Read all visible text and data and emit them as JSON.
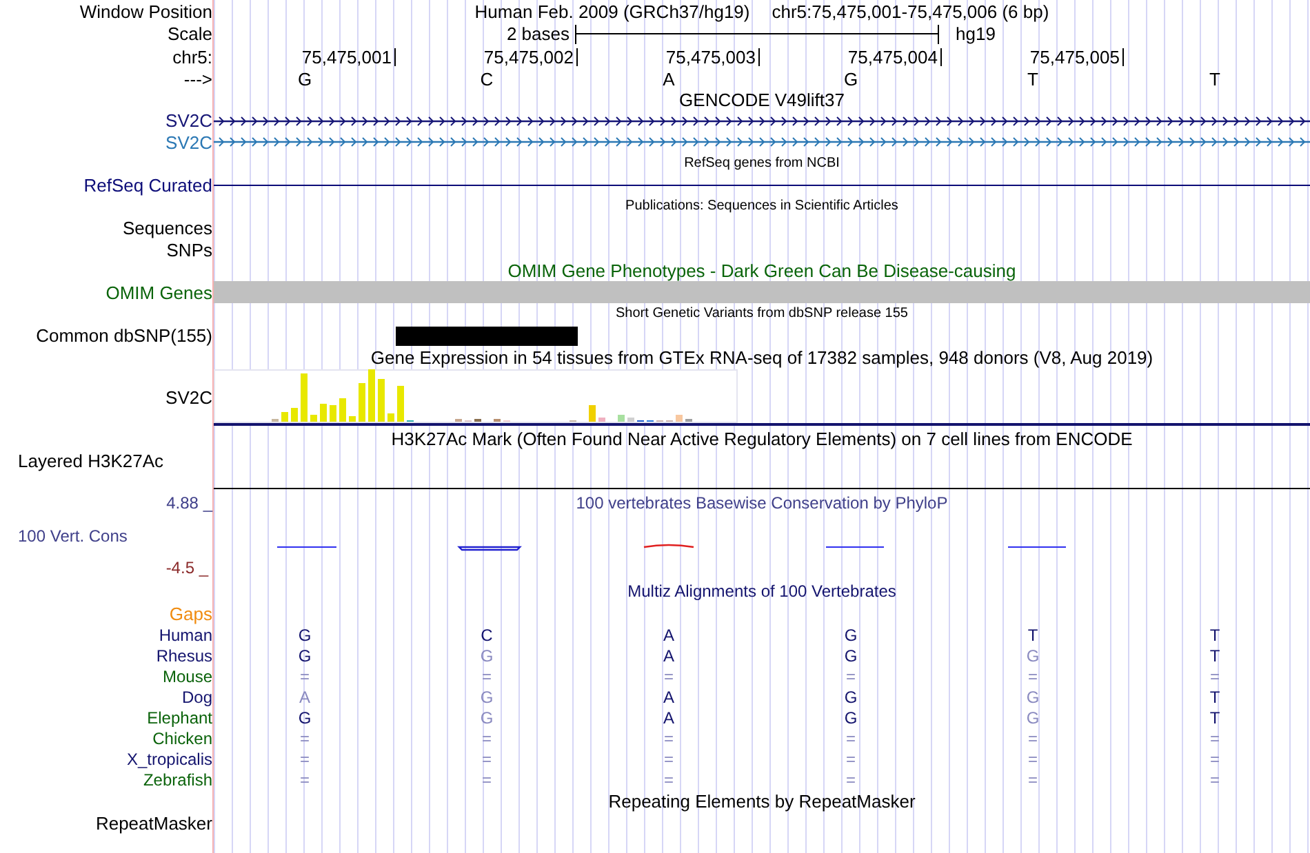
{
  "header": {
    "label": "Window Position",
    "assembly_title": "Human Feb. 2009 (GRCh37/hg19)",
    "position_title": "chr5:75,475,001-75,475,006 (6 bp)"
  },
  "scale": {
    "label": "Scale",
    "text": "2 bases",
    "assembly": "hg19"
  },
  "ruler": {
    "label": "chr5:",
    "positions": [
      "75,475,001",
      "75,475,002",
      "75,475,003",
      "75,475,004",
      "75,475,005"
    ]
  },
  "bases": {
    "label": "--->",
    "sequence": [
      "G",
      "C",
      "A",
      "G",
      "T",
      "T"
    ]
  },
  "gencode": {
    "title": "GENCODE V49lift37",
    "genes": [
      {
        "label": "SV2C",
        "color": "#161676"
      },
      {
        "label": "SV2C",
        "color": "#2b78b4"
      }
    ]
  },
  "refseq": {
    "title": "RefSeq genes from NCBI",
    "label": "RefSeq Curated"
  },
  "publications": {
    "title": "Publications: Sequences in Scientific Articles",
    "label": "Sequences"
  },
  "snps": {
    "label": "SNPs"
  },
  "omim": {
    "title": "OMIM Gene Phenotypes - Dark Green Can Be Disease-causing",
    "label": "OMIM Genes"
  },
  "dbsnp": {
    "title": "Short Genetic Variants from dbSNP release 155",
    "label": "Common dbSNP(155)"
  },
  "gtex": {
    "title": "Gene Expression in 54 tissues from GTEx RNA-seq of 17382 samples, 948 donors (V8, Aug 2019)",
    "label": "SV2C"
  },
  "h3k27ac": {
    "title": "H3K27Ac Mark (Often Found Near Active Regulatory Elements) on 7 cell lines from ENCODE",
    "label": "Layered H3K27Ac"
  },
  "phylop": {
    "title": "100 vertebrates Basewise Conservation by PhyloP",
    "label": "100 Vert. Cons",
    "max": "4.88 _",
    "min": "-4.5 _"
  },
  "multiz": {
    "title": "Multiz Alignments of 100 Vertebrates",
    "gaps_label": "Gaps",
    "species": [
      {
        "name": "Human",
        "color": "#14146e",
        "bases": [
          {
            "text": "G",
            "match": true
          },
          {
            "text": "C",
            "match": true
          },
          {
            "text": "A",
            "match": true
          },
          {
            "text": "G",
            "match": true
          },
          {
            "text": "T",
            "match": true
          },
          {
            "text": "T",
            "match": true
          }
        ]
      },
      {
        "name": "Rhesus",
        "color": "#14146e",
        "bases": [
          {
            "text": "G",
            "match": true
          },
          {
            "text": "G",
            "match": false
          },
          {
            "text": "A",
            "match": true
          },
          {
            "text": "G",
            "match": true
          },
          {
            "text": "G",
            "match": false
          },
          {
            "text": "T",
            "match": true
          }
        ]
      },
      {
        "name": "Mouse",
        "color": "#0b630b",
        "bases": [
          {
            "text": "=",
            "match": false
          },
          {
            "text": "=",
            "match": false
          },
          {
            "text": "=",
            "match": false
          },
          {
            "text": "=",
            "match": false
          },
          {
            "text": "=",
            "match": false
          },
          {
            "text": "=",
            "match": false
          }
        ]
      },
      {
        "name": "Dog",
        "color": "#14146e",
        "bases": [
          {
            "text": "A",
            "match": false
          },
          {
            "text": "G",
            "match": false
          },
          {
            "text": "A",
            "match": true
          },
          {
            "text": "G",
            "match": true
          },
          {
            "text": "G",
            "match": false
          },
          {
            "text": "T",
            "match": true
          }
        ]
      },
      {
        "name": "Elephant",
        "color": "#0b630b",
        "bases": [
          {
            "text": "G",
            "match": true
          },
          {
            "text": "G",
            "match": false
          },
          {
            "text": "A",
            "match": true
          },
          {
            "text": "G",
            "match": true
          },
          {
            "text": "G",
            "match": false
          },
          {
            "text": "T",
            "match": true
          }
        ]
      },
      {
        "name": "Chicken",
        "color": "#0b630b",
        "bases": [
          {
            "text": "=",
            "match": false
          },
          {
            "text": "=",
            "match": false
          },
          {
            "text": "=",
            "match": false
          },
          {
            "text": "=",
            "match": false
          },
          {
            "text": "=",
            "match": false
          },
          {
            "text": "=",
            "match": false
          }
        ]
      },
      {
        "name": "X_tropicalis",
        "color": "#14146e",
        "bases": [
          {
            "text": "=",
            "match": false
          },
          {
            "text": "=",
            "match": false
          },
          {
            "text": "=",
            "match": false
          },
          {
            "text": "=",
            "match": false
          },
          {
            "text": "=",
            "match": false
          },
          {
            "text": "=",
            "match": false
          }
        ]
      },
      {
        "name": "Zebrafish",
        "color": "#0b630b",
        "bases": [
          {
            "text": "=",
            "match": false
          },
          {
            "text": "=",
            "match": false
          },
          {
            "text": "=",
            "match": false
          },
          {
            "text": "=",
            "match": false
          },
          {
            "text": "=",
            "match": false
          },
          {
            "text": "=",
            "match": false
          }
        ]
      }
    ]
  },
  "repeatmasker": {
    "title": "Repeating Elements by RepeatMasker",
    "label": "RepeatMasker"
  }
}
